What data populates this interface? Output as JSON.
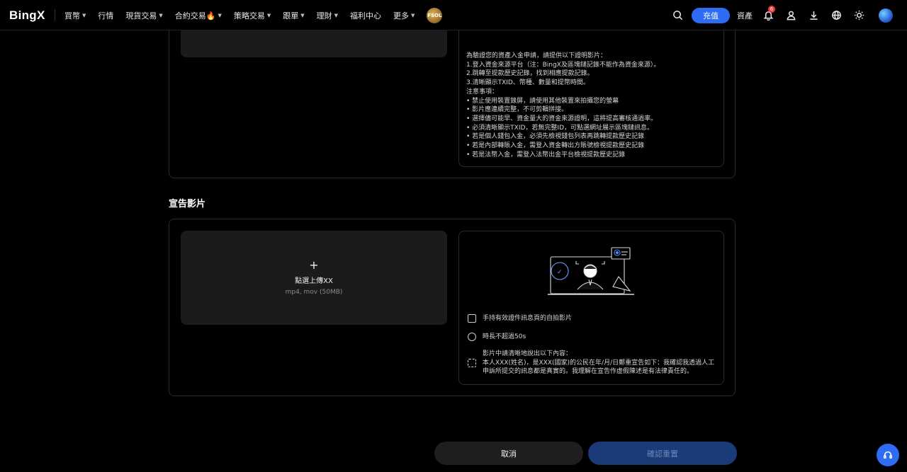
{
  "nav": {
    "logo": "BingX",
    "items": [
      {
        "label": "買幣",
        "caret": true
      },
      {
        "label": "行情",
        "caret": false
      },
      {
        "label": "現貨交易",
        "caret": true
      },
      {
        "label": "合約交易🔥",
        "caret": true
      },
      {
        "label": "策略交易",
        "caret": true
      },
      {
        "label": "跟單",
        "caret": true
      },
      {
        "label": "理財",
        "caret": true
      },
      {
        "label": "福利中心",
        "caret": false
      },
      {
        "label": "更多",
        "caret": true
      }
    ],
    "promo_label": "FSOL",
    "deposit_label": "充值",
    "assets_label": "資產",
    "notification_count": "6"
  },
  "source_section": {
    "instructions": [
      "為驗證您的資產入金申請，請提供以下證明影片：",
      "1.登入資金來源平台（注：BingX及區塊鏈記錄不能作為資金來源）。",
      "2.跳轉至提款歷史記錄，找到相應提款記錄。",
      "3.清晰顯示TXID、幣種、數量和提幣時間。",
      "注意事項：",
      "• 禁止使用裝置錄屏，請使用其他裝置來拍攝您的螢幕",
      "• 影片應連續完整，不可剪輯拼接。",
      "• 選擇儘可能早、資金量大的資金來源證明，這將提高審核通過率。",
      "• 必須清晰顯示TXID，若無完整ID，可點選網址展示區塊鏈訊息。",
      "• 若是個人錢包入金，必須先檢視錢包列表再跳轉提款歷史記錄",
      "• 若是內部轉賬入金，需登入資金轉出方賬號檢視提款歷史記錄",
      "• 若是法幣入金，需登入法幣出金平台檢視提款歷史記錄"
    ]
  },
  "declaration_section": {
    "title": "宣告影片",
    "upload_title": "點選上傳XX",
    "upload_hint": "mp4, mov (50MB)",
    "requirements": {
      "selfie": "手持有效證件訊息頁的自拍影片",
      "duration": "時長不超過50s",
      "script_lines": [
        "影片中請清晰地說出以下內容：",
        "本人XXX(姓名)，是XXX(國家)的公民在年/月/日鄭重宣告如下：我確認我透過人工",
        "申訴所提交的訊息都是真實的。我理解在宣告作虛假陳述是有法律責任的。"
      ]
    }
  },
  "actions": {
    "cancel_label": "取消",
    "confirm_label": "確認重置"
  },
  "colors": {
    "accent": "#2e6cf5",
    "confirm_disabled": "#1a3a78",
    "badge": "#ef3b3b"
  }
}
